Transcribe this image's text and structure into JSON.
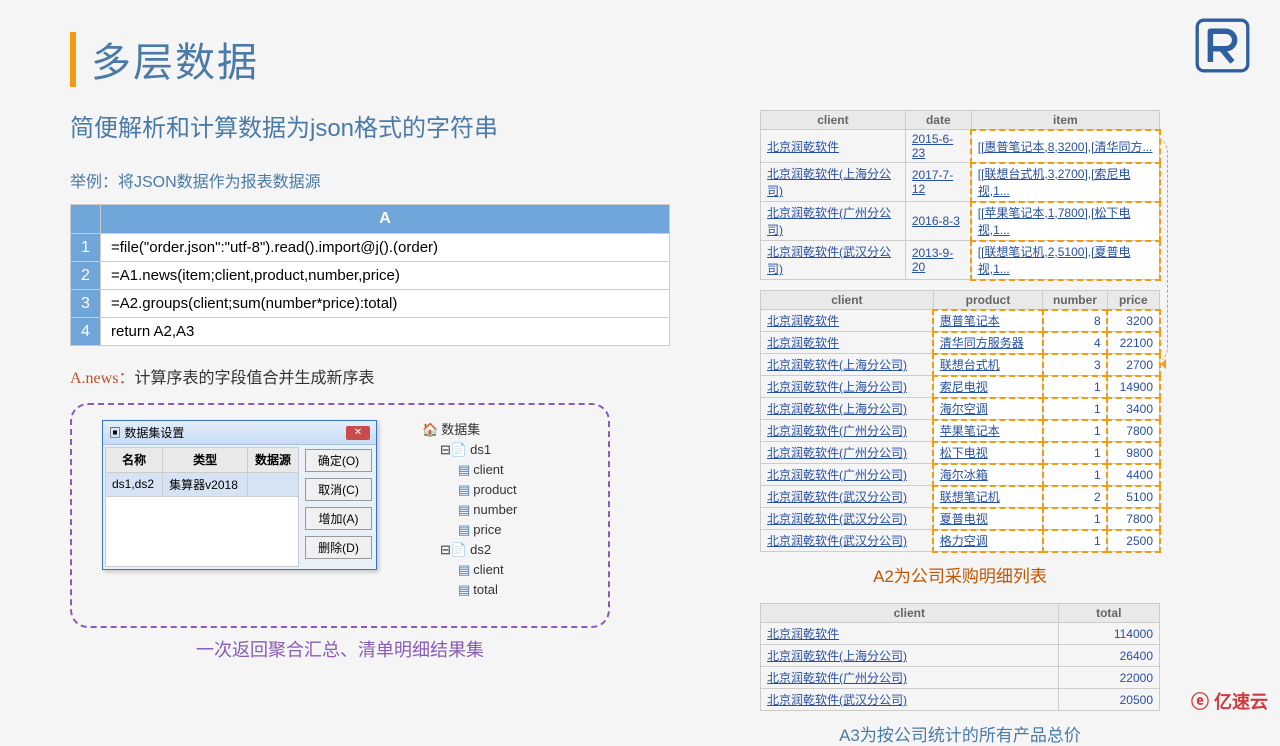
{
  "title": "多层数据",
  "subtitle": "简便解析和计算数据为json格式的字符串",
  "example_label": "举例：将JSON数据作为报表数据源",
  "code": {
    "header": "A",
    "rows": [
      {
        "n": "1",
        "c": "=file(\"order.json\":\"utf-8\").read().import@j().(order)"
      },
      {
        "n": "2",
        "c": "=A1.news(item;client,product,number,price)"
      },
      {
        "n": "3",
        "c": "=A2.groups(client;sum(number*price):total)"
      },
      {
        "n": "4",
        "c": "return A2,A3"
      }
    ]
  },
  "news_label": "A.news：",
  "news_desc": "计算序表的字段值合并生成新序表",
  "dialog": {
    "title": "数据集设置",
    "cols": [
      "名称",
      "类型",
      "数据源"
    ],
    "row": [
      "ds1,ds2",
      "集算器v2018",
      ""
    ],
    "buttons": [
      "确定(O)",
      "取消(C)",
      "增加(A)",
      "删除(D)"
    ]
  },
  "tree": {
    "root": "数据集",
    "ds1": "ds1",
    "ds1_items": [
      "client",
      "product",
      "number",
      "price"
    ],
    "ds2": "ds2",
    "ds2_items": [
      "client",
      "total"
    ]
  },
  "dashed_caption": "一次返回聚合汇总、清单明细结果集",
  "table1": {
    "headers": [
      "client",
      "date",
      "item"
    ],
    "rows": [
      [
        "北京润乾软件",
        "2015-6-23",
        "[[惠普笔记本,8,3200],[清华同方..."
      ],
      [
        "北京润乾软件(上海分公司)",
        "2017-7-12",
        "[[联想台式机,3,2700],[索尼电视,1..."
      ],
      [
        "北京润乾软件(广州分公司)",
        "2016-8-3",
        "[[苹果笔记本,1,7800],[松下电视,1..."
      ],
      [
        "北京润乾软件(武汉分公司)",
        "2013-9-20",
        "[[联想笔记机,2,5100],[夏普电视,1..."
      ]
    ]
  },
  "table2": {
    "headers": [
      "client",
      "product",
      "number",
      "price"
    ],
    "rows": [
      [
        "北京润乾软件",
        "惠普笔记本",
        "8",
        "3200"
      ],
      [
        "北京润乾软件",
        "清华同方服务器",
        "4",
        "22100"
      ],
      [
        "北京润乾软件(上海分公司)",
        "联想台式机",
        "3",
        "2700"
      ],
      [
        "北京润乾软件(上海分公司)",
        "索尼电视",
        "1",
        "14900"
      ],
      [
        "北京润乾软件(上海分公司)",
        "海尔空调",
        "1",
        "3400"
      ],
      [
        "北京润乾软件(广州分公司)",
        "苹果笔记本",
        "1",
        "7800"
      ],
      [
        "北京润乾软件(广州分公司)",
        "松下电视",
        "1",
        "9800"
      ],
      [
        "北京润乾软件(广州分公司)",
        "海尔冰箱",
        "1",
        "4400"
      ],
      [
        "北京润乾软件(武汉分公司)",
        "联想笔记机",
        "2",
        "5100"
      ],
      [
        "北京润乾软件(武汉分公司)",
        "夏普电视",
        "1",
        "7800"
      ],
      [
        "北京润乾软件(武汉分公司)",
        "格力空调",
        "1",
        "2500"
      ]
    ]
  },
  "caption_a2": "A2为公司采购明细列表",
  "table3": {
    "headers": [
      "client",
      "total"
    ],
    "rows": [
      [
        "北京润乾软件",
        "114000"
      ],
      [
        "北京润乾软件(上海分公司)",
        "26400"
      ],
      [
        "北京润乾软件(广州分公司)",
        "22000"
      ],
      [
        "北京润乾软件(武汉分公司)",
        "20500"
      ]
    ]
  },
  "caption_a3": "A3为按公司统计的所有产品总价",
  "logo_yisu": "亿速云"
}
